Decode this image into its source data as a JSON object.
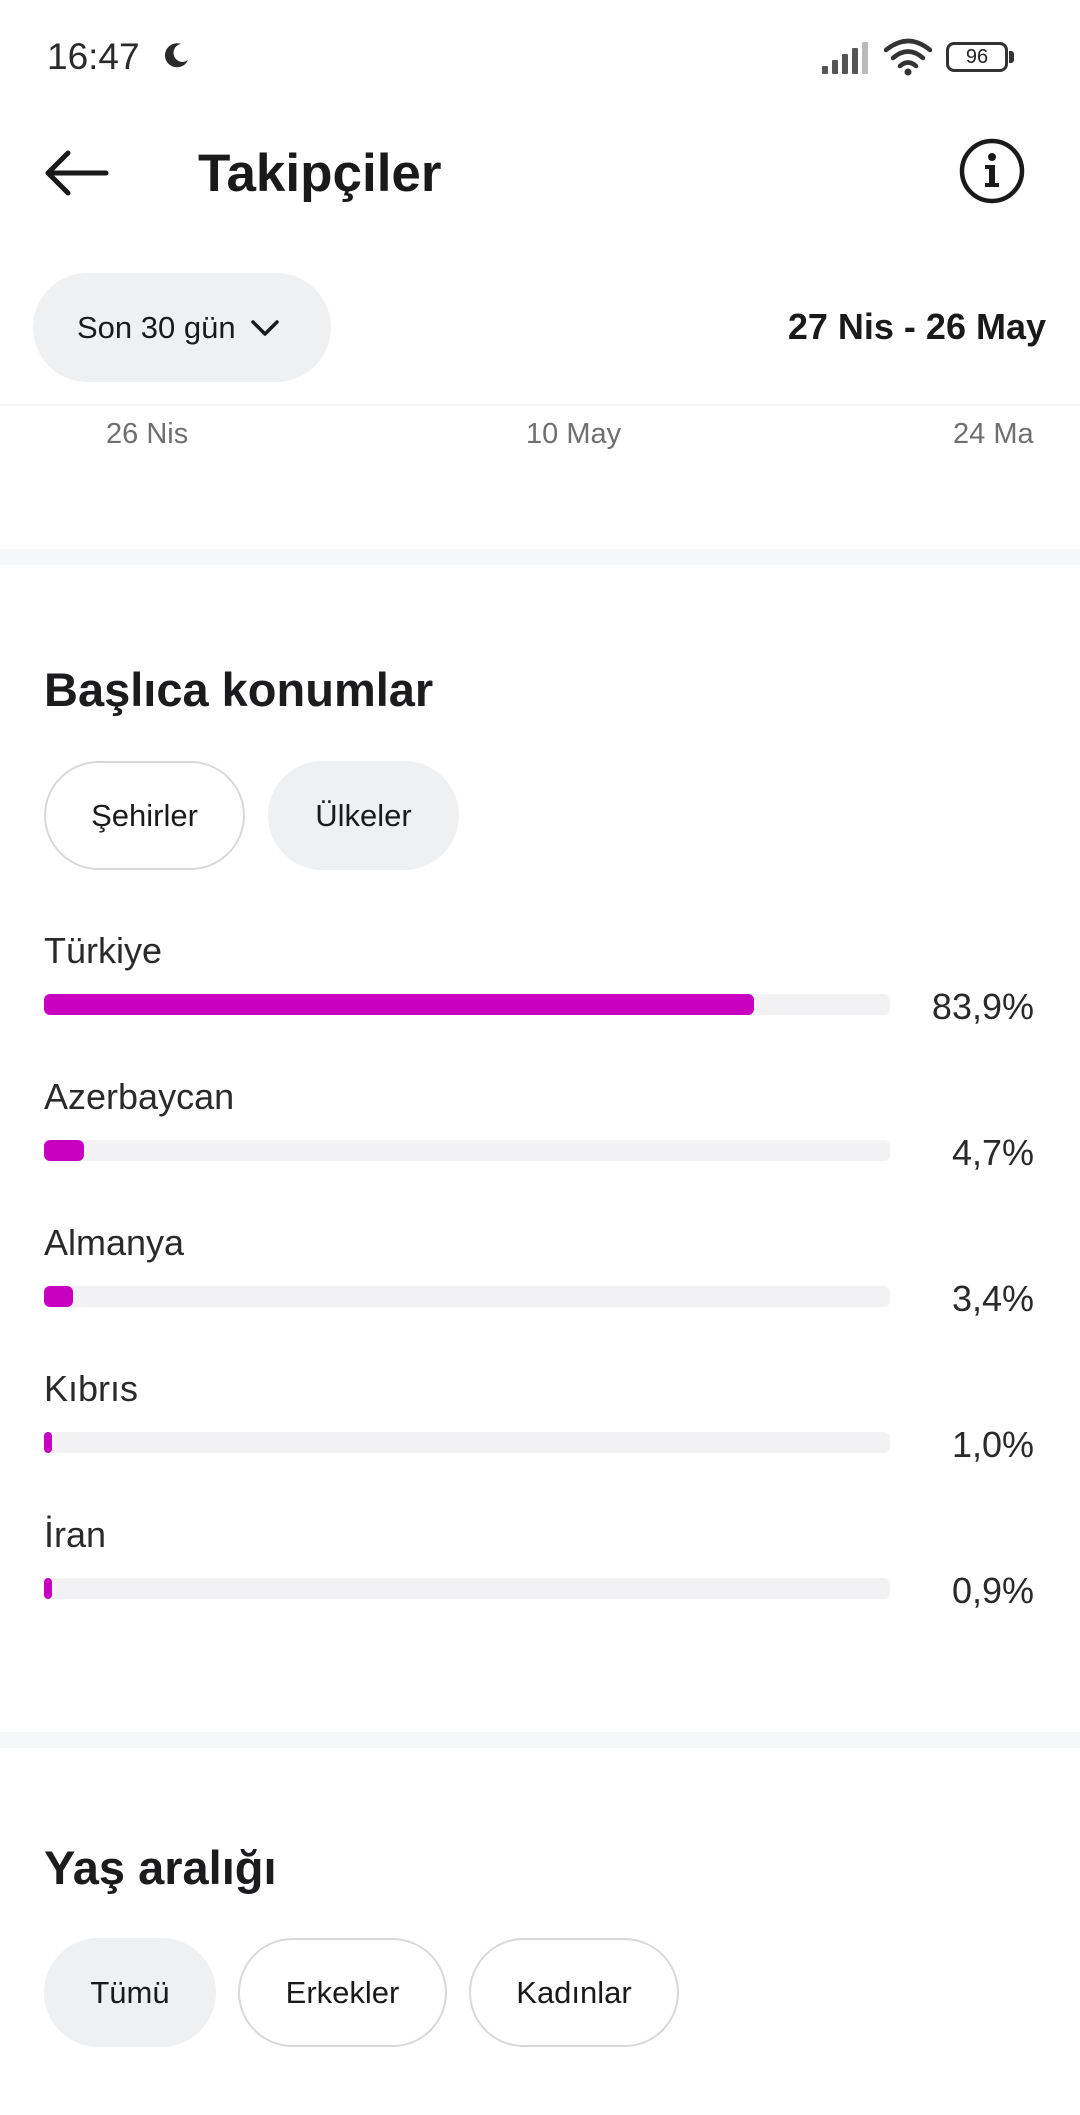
{
  "status_bar": {
    "time": "16:47",
    "battery": "96"
  },
  "header": {
    "title": "Takipçiler"
  },
  "period": {
    "label": "Son 30 gün",
    "date_range": "27 Nis - 26 May"
  },
  "chart_ticks": [
    "26 Nis",
    "10 May",
    "24 Ma"
  ],
  "locations": {
    "title": "Başlıca konumlar",
    "tabs": [
      "Şehirler",
      "Ülkeler"
    ],
    "items": [
      {
        "name": "Türkiye",
        "percent": "83,9%",
        "value": 83.9
      },
      {
        "name": "Azerbaycan",
        "percent": "4,7%",
        "value": 4.7
      },
      {
        "name": "Almanya",
        "percent": "3,4%",
        "value": 3.4
      },
      {
        "name": "Kıbrıs",
        "percent": "1,0%",
        "value": 1.0
      },
      {
        "name": "İran",
        "percent": "0,9%",
        "value": 0.9
      }
    ],
    "bar_color": "#c800c0"
  },
  "age": {
    "title": "Yaş aralığı",
    "tabs": [
      "Tümü",
      "Erkekler",
      "Kadınlar"
    ]
  }
}
